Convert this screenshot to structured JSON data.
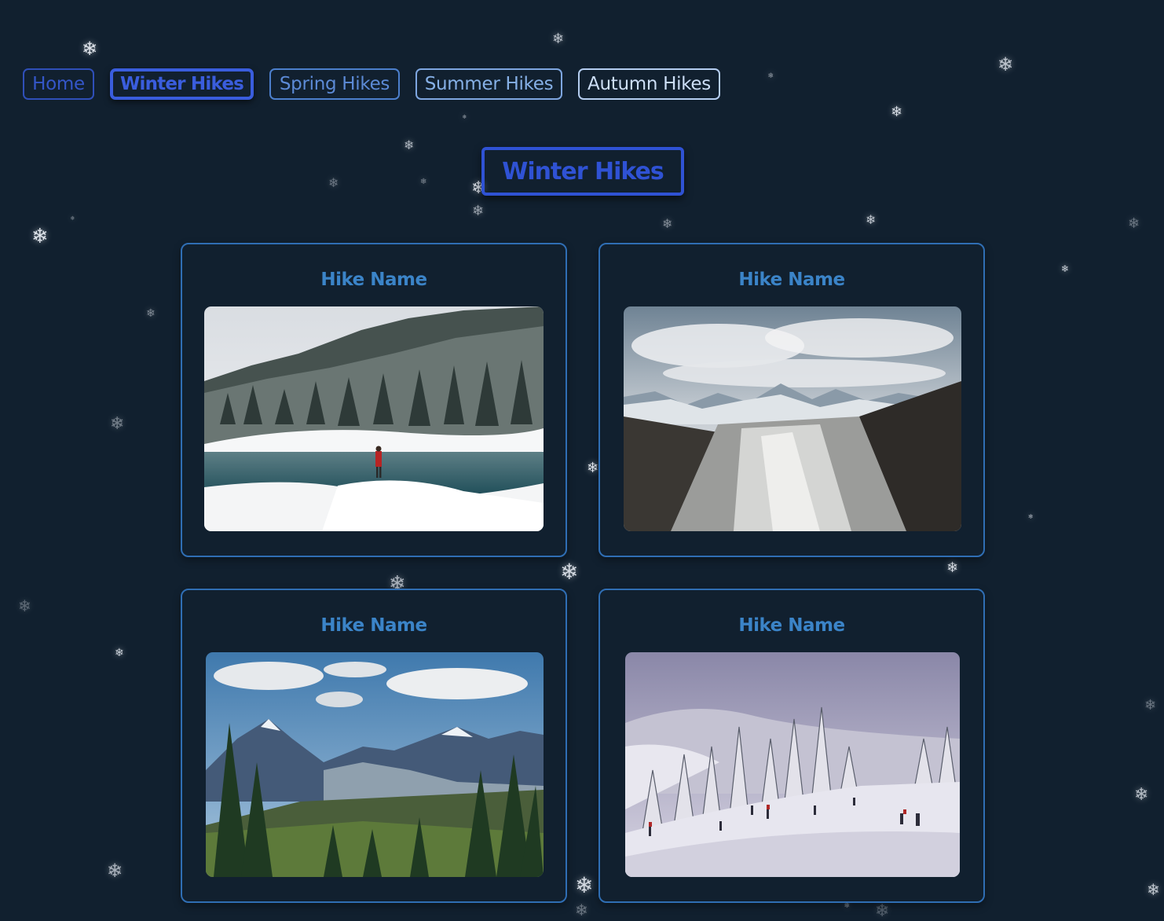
{
  "nav": {
    "items": [
      {
        "label": "Home"
      },
      {
        "label": "Winter Hikes"
      },
      {
        "label": "Spring Hikes"
      },
      {
        "label": "Summer Hikes"
      },
      {
        "label": "Autumn Hikes"
      }
    ],
    "active": "Winter Hikes"
  },
  "page": {
    "title": "Winter Hikes"
  },
  "hikes": [
    {
      "name": "Hike Name",
      "image": "snowy-forest-lake-hiker"
    },
    {
      "name": "Hike Name",
      "image": "glacier-valley-mountains"
    },
    {
      "name": "Hike Name",
      "image": "mountain-valley-pine-forest"
    },
    {
      "name": "Hike Name",
      "image": "ski-slope-snowy-trees-skiers"
    }
  ],
  "decor": {
    "snowflake_glyph": "❄"
  },
  "colors": {
    "background": "#11202f",
    "accent": "#2f52d4",
    "card_border": "#2f6eb4",
    "card_title": "#3b84c8"
  }
}
